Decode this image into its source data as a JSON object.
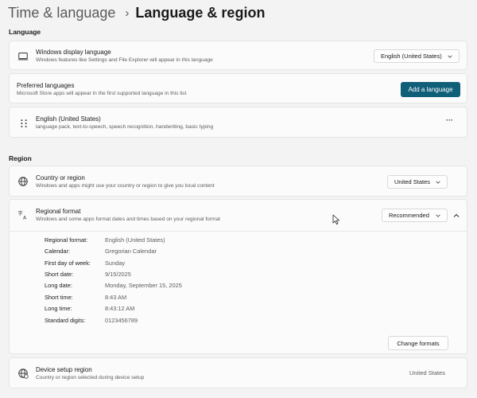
{
  "breadcrumb": {
    "parent": "Time & language",
    "separator": "›",
    "current": "Language & region"
  },
  "language_section": {
    "title": "Language",
    "display_language": {
      "title": "Windows display language",
      "subtitle": "Windows features like Settings and File Explorer will appear in this language",
      "selected": "English (United States)",
      "icon": "monitor-icon"
    },
    "preferred_languages": {
      "title": "Preferred languages",
      "subtitle": "Microsoft Store apps will appear in the first supported language in this list",
      "button": "Add a language"
    },
    "language_item": {
      "title": "English (United States)",
      "subtitle": "language pack, text-to-speech, speech recognition, handwriting, basic typing",
      "more": "···",
      "icon": "drag-handle-icon"
    }
  },
  "region_section": {
    "title": "Region",
    "country": {
      "title": "Country or region",
      "subtitle": "Windows and apps might use your country or region to give you local content",
      "selected": "United States",
      "icon": "globe-icon"
    },
    "regional_format": {
      "title": "Regional format",
      "subtitle": "Windows and some apps format dates and times based on your regional format",
      "selected": "Recommended",
      "icon": "language-format-icon",
      "details": [
        {
          "label": "Regional format:",
          "value": "English (United States)"
        },
        {
          "label": "Calendar:",
          "value": "Gregorian Calendar"
        },
        {
          "label": "First day of week:",
          "value": "Sunday"
        },
        {
          "label": "Short date:",
          "value": "9/15/2025"
        },
        {
          "label": "Long date:",
          "value": "Monday, September 15, 2025"
        },
        {
          "label": "Short time:",
          "value": "8:43 AM"
        },
        {
          "label": "Long time:",
          "value": "8:43:12 AM"
        },
        {
          "label": "Standard digits:",
          "value": "0123456789"
        }
      ],
      "change_button": "Change formats"
    },
    "device_setup": {
      "title": "Device setup region",
      "subtitle": "Country or region selected during device setup",
      "value": "United States",
      "icon": "globe-setup-icon"
    }
  },
  "colors": {
    "accent": "#0f5f78",
    "background": "#f3f3f3",
    "card": "#fbfbfb"
  }
}
